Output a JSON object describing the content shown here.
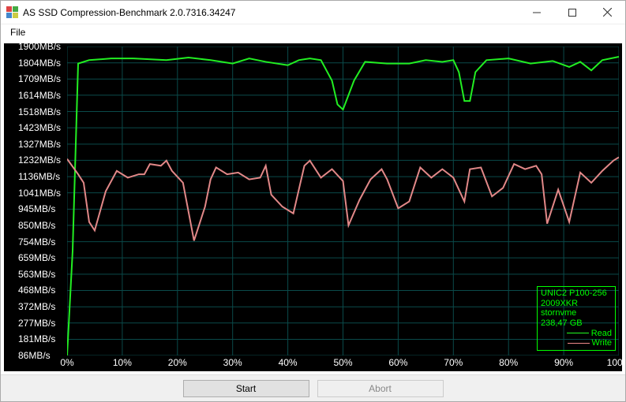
{
  "window": {
    "title": "AS SSD Compression-Benchmark 2.0.7316.34247",
    "icon_colors": [
      "#d44",
      "#4a4",
      "#48c",
      "#cc4"
    ]
  },
  "menu": {
    "file": "File"
  },
  "buttons": {
    "start": "Start",
    "abort": "Abort"
  },
  "legend": {
    "device": "UNIC2 P100-256",
    "serial": "2009XKR",
    "driver": "stornvme",
    "capacity": "238,47 GB",
    "read_label": "Read",
    "write_label": "Write"
  },
  "chart_data": {
    "type": "line",
    "xlabel": "",
    "ylabel": "",
    "x_ticks_pct": [
      0,
      10,
      20,
      30,
      40,
      50,
      60,
      70,
      80,
      90,
      100
    ],
    "y_ticks": [
      86,
      181,
      277,
      372,
      468,
      563,
      659,
      754,
      850,
      945,
      1041,
      1136,
      1232,
      1327,
      1423,
      1518,
      1614,
      1709,
      1804,
      1900
    ],
    "y_unit": "MB/s",
    "ylim": [
      86,
      1900
    ],
    "series": [
      {
        "name": "Read",
        "color": "#22ee22",
        "x_pct": [
          0,
          1,
          2,
          4,
          8,
          12,
          18,
          22,
          26,
          30,
          33,
          36,
          40,
          42,
          44,
          46,
          48,
          49,
          50,
          52,
          54,
          58,
          62,
          65,
          68,
          70,
          71,
          72,
          73,
          74,
          76,
          80,
          84,
          88,
          91,
          93,
          95,
          97,
          100
        ],
        "values": [
          86,
          700,
          1800,
          1820,
          1830,
          1830,
          1820,
          1835,
          1820,
          1800,
          1830,
          1810,
          1790,
          1820,
          1830,
          1820,
          1700,
          1560,
          1530,
          1700,
          1810,
          1800,
          1800,
          1820,
          1810,
          1820,
          1750,
          1580,
          1580,
          1750,
          1820,
          1830,
          1800,
          1815,
          1780,
          1810,
          1760,
          1820,
          1840
        ]
      },
      {
        "name": "Write",
        "color": "#e28888",
        "x_pct": [
          0,
          2,
          3,
          4,
          5,
          7,
          9,
          11,
          13,
          14,
          15,
          17,
          18,
          19,
          21,
          23,
          25,
          26,
          27,
          29,
          31,
          33,
          35,
          36,
          37,
          39,
          41,
          43,
          44,
          46,
          48,
          50,
          51,
          53,
          55,
          57,
          58,
          60,
          62,
          64,
          66,
          68,
          70,
          72,
          73,
          75,
          77,
          79,
          81,
          83,
          85,
          86,
          87,
          89,
          91,
          93,
          95,
          97,
          99,
          100
        ],
        "values": [
          1240,
          1150,
          1100,
          870,
          820,
          1050,
          1170,
          1130,
          1150,
          1150,
          1210,
          1200,
          1230,
          1170,
          1100,
          760,
          960,
          1120,
          1190,
          1150,
          1160,
          1120,
          1130,
          1200,
          1030,
          960,
          920,
          1200,
          1230,
          1130,
          1180,
          1110,
          850,
          1000,
          1120,
          1180,
          1120,
          950,
          990,
          1190,
          1130,
          1180,
          1130,
          990,
          1180,
          1190,
          1020,
          1070,
          1210,
          1180,
          1200,
          1150,
          860,
          1060,
          870,
          1160,
          1100,
          1170,
          1230,
          1250
        ]
      }
    ]
  }
}
